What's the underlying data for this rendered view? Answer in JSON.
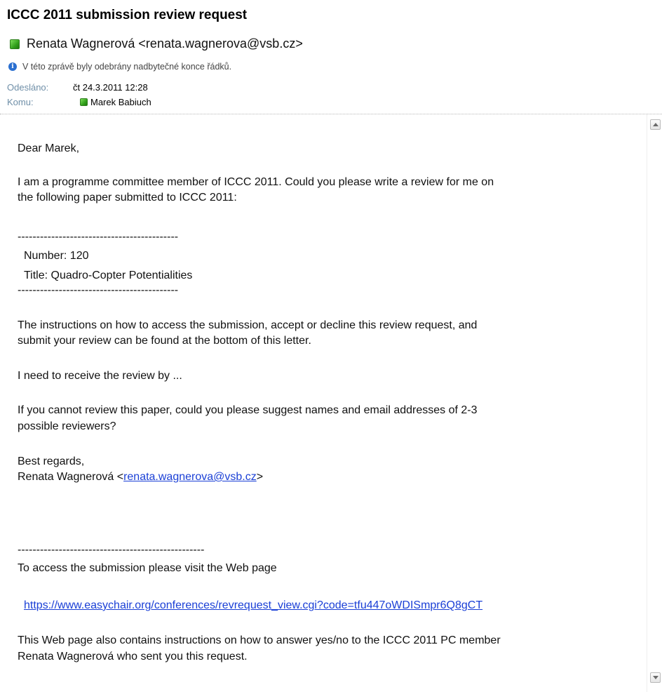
{
  "email": {
    "subject": "ICCC 2011 submission review request",
    "sender": "Renata Wagnerová <renata.wagnerova@vsb.cz>",
    "info_notice": "V této zprávě byly odebrány nadbytečné konce řádků.",
    "sent_label": "Odesláno:",
    "sent_value": "čt 24.3.2011 12:28",
    "to_label": "Komu:",
    "to_value": "Marek Babiuch"
  },
  "body": {
    "greeting": "Dear Marek,",
    "intro_line1": "I am a programme committee member of ICCC 2011. Could you please write a review for me on",
    "intro_line2": "the following paper submitted to ICCC 2011:",
    "rule_short": "-------------------------------------------",
    "paper_number": "Number: 120",
    "paper_title": "Title: Quadro-Copter Potentialities",
    "rule_short_2": "-------------------------------------------",
    "instructions_line1": "The instructions on how to access the submission, accept or decline this review request, and",
    "instructions_line2": "submit your review can be found at the bottom of this letter.",
    "deadline": "I need to receive the review by ...",
    "suggest_line1": "If you cannot review this paper, could you please suggest names and email addresses of 2-3",
    "suggest_line2": "possible reviewers?",
    "regards": "Best regards,",
    "signature_name": "Renata Wagnerová <",
    "signature_email": "renata.wagnerova@vsb.cz",
    "signature_end": ">",
    "rule_long": "--------------------------------------------------",
    "access_line": "To access the submission please visit the Web page",
    "access_url": "https://www.easychair.org/conferences/revrequest_view.cgi?code=tfu447oWDISmpr6Q8gCT",
    "webpage_line1": "This Web page also contains instructions on how to answer yes/no to the ICCC 2011 PC member",
    "webpage_line2": "Renata Wagnerová who sent you this request."
  },
  "colors": {
    "link": "#1a3fd6",
    "meta_label": "#6f8fa8",
    "presence_green": "#33a11c",
    "info_blue": "#2a6fd0"
  },
  "icons": {
    "presence": "presence-status-icon",
    "info": "info-icon",
    "scroll_up": "scroll-up-arrow-icon",
    "scroll_down": "scroll-down-arrow-icon"
  }
}
